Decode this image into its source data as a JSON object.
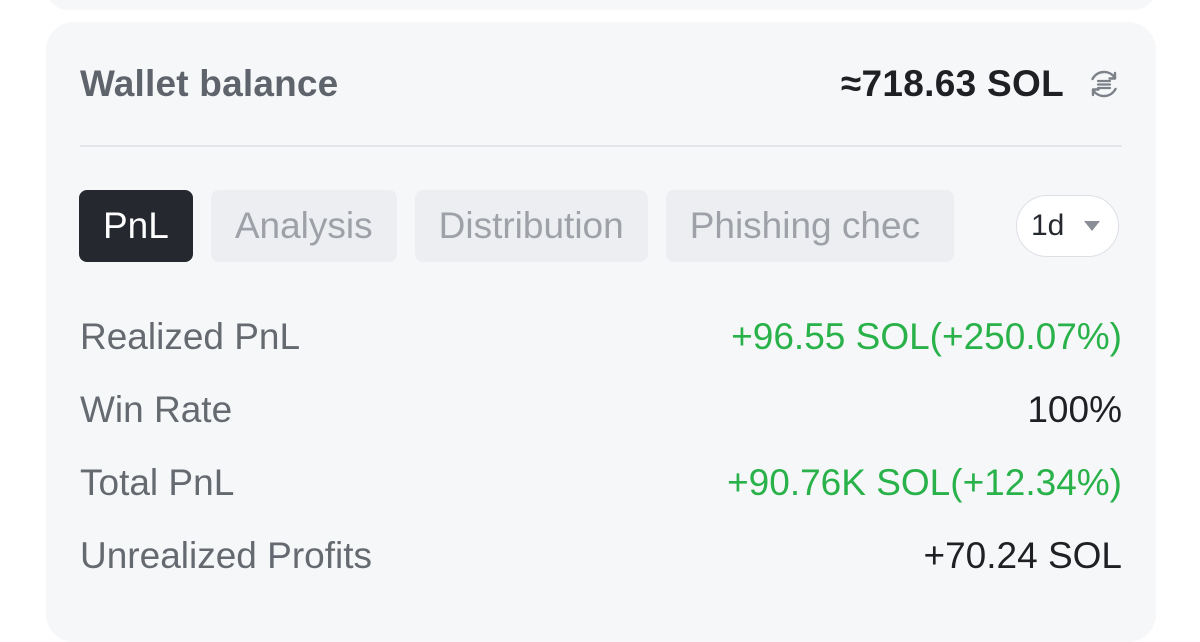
{
  "wallet": {
    "title": "Wallet balance",
    "balance": "≈718.63 SOL",
    "refresh_icon": "refresh-icon"
  },
  "tabs": [
    {
      "label": "PnL",
      "active": true
    },
    {
      "label": "Analysis",
      "active": false
    },
    {
      "label": "Distribution",
      "active": false
    },
    {
      "label": "Phishing chec",
      "active": false
    }
  ],
  "period": {
    "selected": "1d",
    "icon": "caret-down-icon"
  },
  "stats": [
    {
      "label": "Realized PnL",
      "value": "+96.55 SOL(+250.07%)",
      "color": "#2ab24a"
    },
    {
      "label": "Win Rate",
      "value": "100%",
      "color": "#1f2024"
    },
    {
      "label": "Total PnL",
      "value": "+90.76K SOL(+12.34%)",
      "color": "#2ab24a"
    },
    {
      "label": "Unrealized Profits",
      "value": "+70.24 SOL",
      "color": "#1f2024"
    }
  ],
  "colors": {
    "positive": "#2ab24a",
    "text_primary": "#1f2024",
    "text_secondary": "#656970",
    "tab_active_bg": "#25282e",
    "card_bg": "#f6f7f9"
  }
}
